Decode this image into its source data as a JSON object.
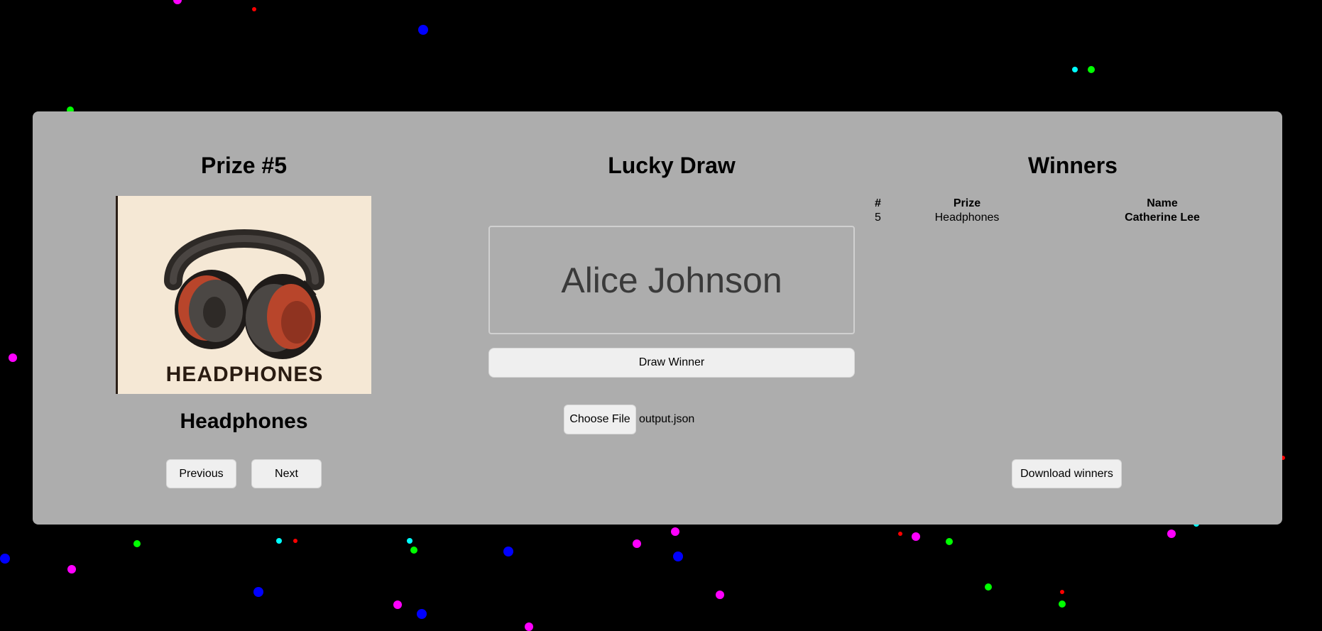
{
  "prize_panel": {
    "heading": "Prize #5",
    "image_caption": "HEADPHONES",
    "image_subject": "headphones-icon",
    "prize_name": "Headphones",
    "previous_label": "Previous",
    "next_label": "Next"
  },
  "draw_panel": {
    "heading": "Lucky Draw",
    "current_name": "Alice Johnson",
    "draw_button_label": "Draw Winner",
    "file_button_label": "Choose File",
    "file_name": "output.json"
  },
  "winners_panel": {
    "heading": "Winners",
    "columns": [
      "#",
      "Prize",
      "Name"
    ],
    "rows": [
      {
        "num": "5",
        "prize": "Headphones",
        "name": "Catherine Lee"
      }
    ],
    "download_label": "Download winners"
  },
  "colors": {
    "background": "#000000",
    "panel": "#adadad",
    "button": "#efefef",
    "confetti": [
      "#ff00ff",
      "#0000ff",
      "#00ff00",
      "#00ffff",
      "#ff0000"
    ]
  }
}
